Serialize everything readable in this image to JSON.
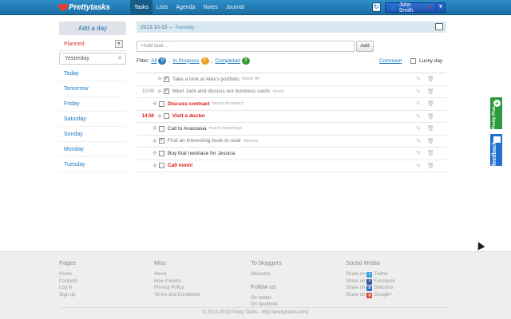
{
  "app": {
    "logo_prefix": "Pretty",
    "logo_suffix": "tasks"
  },
  "nav": [
    "Tasks",
    "Lists",
    "Agenda",
    "Notes",
    "Journal"
  ],
  "nav_active": "Tasks",
  "user": {
    "name": "John Smith"
  },
  "sidebar": {
    "add_day": "Add a day",
    "planned": "Planned",
    "yesterday_value": "Yesterday",
    "days": [
      "Today",
      "Tomorrow",
      "Friday",
      "Saturday",
      "Sunday",
      "Monday",
      "Tuesday"
    ]
  },
  "main": {
    "date": "2013-10-15",
    "day_name": "Tuesday",
    "add_placeholder": "+Add task ...",
    "add_button": "Add",
    "filter_label": "Filter:",
    "filters": [
      {
        "label": "All",
        "count": "8",
        "color": "#2f7fc0"
      },
      {
        "label": "In Progress",
        "count": "5",
        "color": "#f0a020"
      },
      {
        "label": "Completed",
        "count": "3",
        "color": "#3a9a3a"
      }
    ],
    "comment_link": "Comment",
    "lucky_day": "Lucky day",
    "tasks": [
      {
        "time": "",
        "text": "Take a look at Alex's portfolio",
        "tags": "#work #tr",
        "done": true,
        "red": false,
        "indent": false
      },
      {
        "time": "10:00",
        "text": "Meet Jack and discuss our business cards",
        "tags": "#work",
        "done": true,
        "red": false,
        "indent": false
      },
      {
        "time": "",
        "text": "Discuss contract",
        "tags": "#work #contract",
        "done": false,
        "red": true,
        "indent": true
      },
      {
        "time": "14:50",
        "text": "Visit a doctor",
        "tags": "",
        "done": false,
        "red": true,
        "indent": false,
        "red_time": true
      },
      {
        "time": "",
        "text": "Call to Anastasia",
        "tags": "#work #meetings",
        "done": false,
        "red": false,
        "indent": true
      },
      {
        "time": "",
        "text": "Find an interesting book to read",
        "tags": "#leisure",
        "done": true,
        "red": false,
        "indent": true
      },
      {
        "time": "",
        "text": "Buy that necklace for Jessica",
        "tags": "",
        "done": false,
        "red": false,
        "indent": true
      },
      {
        "time": "",
        "text": "Call mom!",
        "tags": "",
        "done": false,
        "red": true,
        "indent": true
      }
    ]
  },
  "widgets": {
    "plus_text": "Pretty Plus",
    "feedback_text": "feedback"
  },
  "footer": {
    "pages_title": "Pages",
    "pages": [
      "Home",
      "Contacts",
      "Log in",
      "Sign up"
    ],
    "misc_title": "Misc",
    "misc": [
      "About",
      "How it works",
      "Privacy Policy",
      "Terms and Conditions"
    ],
    "bloggers_title": "To bloggers",
    "bloggers": [
      "Welcome"
    ],
    "follow_title": "Follow us",
    "follow": [
      "On twitter",
      "On facebook"
    ],
    "social_title": "Social Media",
    "share_prefix": "Share on",
    "social": [
      {
        "name": "Twitter",
        "icon": "twitter-icon",
        "color": "#3aa0e0",
        "glyph": "t"
      },
      {
        "name": "Facebook",
        "icon": "facebook-icon",
        "color": "#3b5998",
        "glyph": "f"
      },
      {
        "name": "Delicious",
        "icon": "delicious-icon",
        "color": "#2a6fd0",
        "glyph": "d"
      },
      {
        "name": "Google+",
        "icon": "googleplus-icon",
        "color": "#d34836",
        "glyph": "g"
      }
    ],
    "copyright": "© 2012-2013 Pretty Tasks - http://prettytasks.com/"
  }
}
